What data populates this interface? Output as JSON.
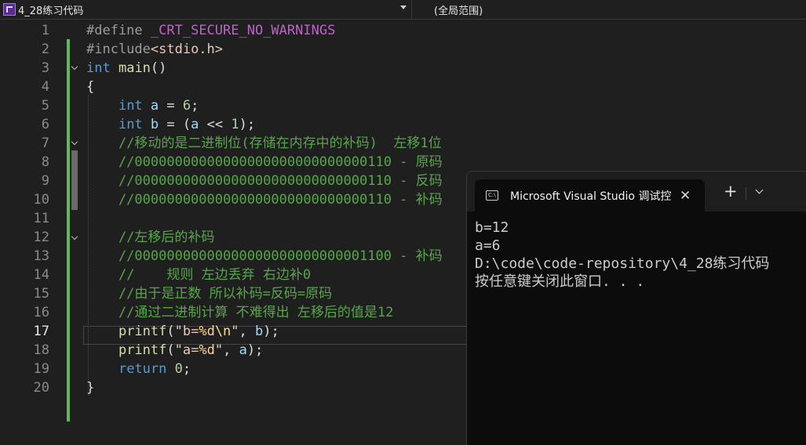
{
  "navbar": {
    "project_scope": "4_28练习代码",
    "member_scope": "(全局范围)"
  },
  "editor": {
    "line_numbers": [
      "1",
      "2",
      "3",
      "4",
      "5",
      "6",
      "7",
      "8",
      "9",
      "10",
      "11",
      "12",
      "13",
      "14",
      "15",
      "16",
      "17",
      "18",
      "19",
      "20"
    ],
    "current_line": "17"
  },
  "console": {
    "tab_title": "Microsoft Visual Studio 调试控",
    "output": [
      "b=12",
      "a=6",
      "D:\\code\\code-repository\\4_28练习代码",
      "按任意键关闭此窗口. . ."
    ]
  },
  "colors": {
    "background": "#1f1f1f",
    "keyword": "#569cd6",
    "comment": "#57a64a",
    "string": "#e8c9bb",
    "macro": "#bd63c5",
    "change_bar": "#5fb85d",
    "console_bg": "#0c0c0c"
  },
  "icons": [
    "project-icon",
    "chevron-down-icon",
    "fold-chevron-icon",
    "terminal-icon",
    "close-icon",
    "plus-icon"
  ]
}
